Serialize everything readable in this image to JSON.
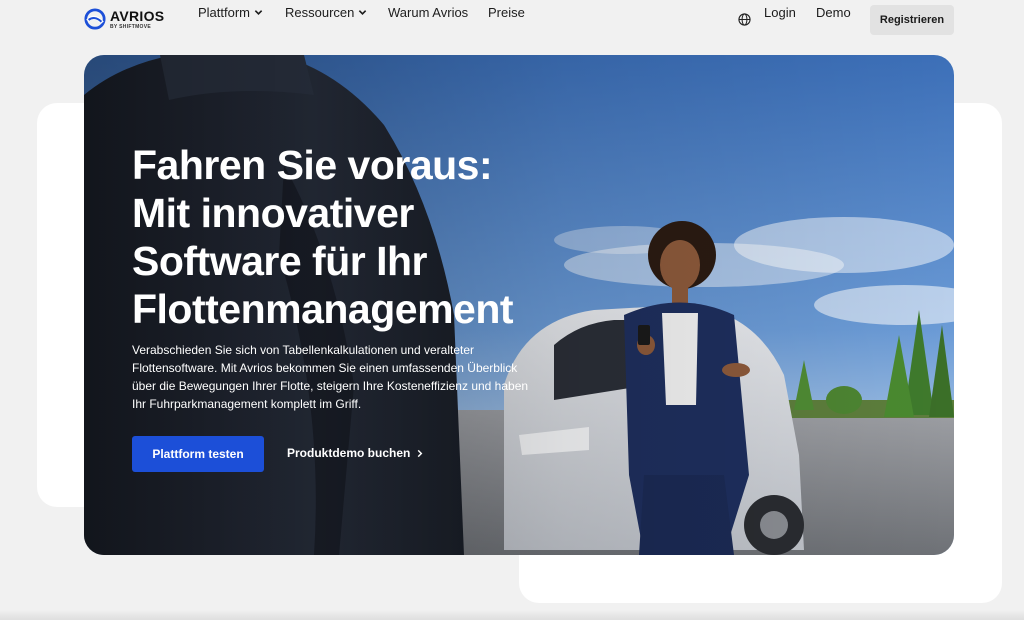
{
  "brand": {
    "name": "AVRIOS",
    "sub": "BY SHIFTMOVE",
    "accent": "#1c4fd8"
  },
  "nav": {
    "items": [
      {
        "label": "Plattform",
        "has_dropdown": true,
        "icon": "chevron-down-icon"
      },
      {
        "label": "Ressourcen",
        "has_dropdown": true,
        "icon": "chevron-down-icon"
      },
      {
        "label": "Warum Avrios",
        "has_dropdown": false
      },
      {
        "label": "Preise",
        "has_dropdown": false
      }
    ],
    "language_icon": "globe-icon",
    "login": "Login",
    "demo": "Demo",
    "register": "Registrieren"
  },
  "hero": {
    "title_lines": [
      "Fahren Sie voraus:",
      "Mit innovativer",
      "Software für Ihr",
      "Flottenmanagement"
    ],
    "description_lines": [
      "Verabschieden Sie sich von Tabellenkalkulationen und veralteter",
      "Flottensoftware. Mit Avrios bekommen Sie einen umfassenden Überblick",
      "über die Bewegungen Ihrer Flotte, steigern Ihre Kosteneffizienz und haben",
      "Ihr Fuhrparkmanagement komplett im Griff."
    ],
    "primary_cta": "Plattform testen",
    "secondary_cta": "Produktdemo buchen",
    "secondary_cta_icon": "chevron-right-icon"
  }
}
